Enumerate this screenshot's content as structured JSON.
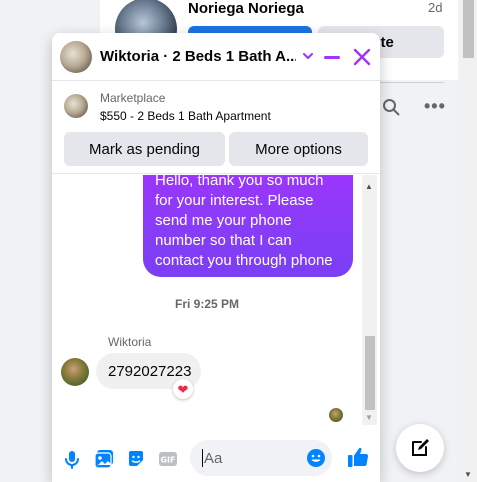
{
  "background": {
    "contact_name": "Noriega Noriega",
    "time": "2d",
    "delete_label": "lete"
  },
  "chat": {
    "title": "Wiktoria · 2 Beds 1 Bath A...",
    "marketplace": {
      "source": "Marketplace",
      "listing": "$550 - 2 Beds 1 Bath Apartment"
    },
    "buttons": {
      "mark_pending": "Mark as pending",
      "more_options": "More options"
    },
    "messages": {
      "outgoing_lines": [
        "Hello, thank you so much",
        "for your interest. Please",
        "send me your phone",
        "number so that I can",
        "contact you through phone"
      ],
      "timestamp": "Fri 9:25 PM",
      "incoming_sender": "Wiktoria",
      "incoming_text": "2792027223",
      "reaction": "❤"
    },
    "composer": {
      "placeholder": "Aa"
    }
  },
  "colors": {
    "accent": "#a033ff",
    "messenger_blue": "#0084ff",
    "facebook_blue": "#1b74e4"
  }
}
